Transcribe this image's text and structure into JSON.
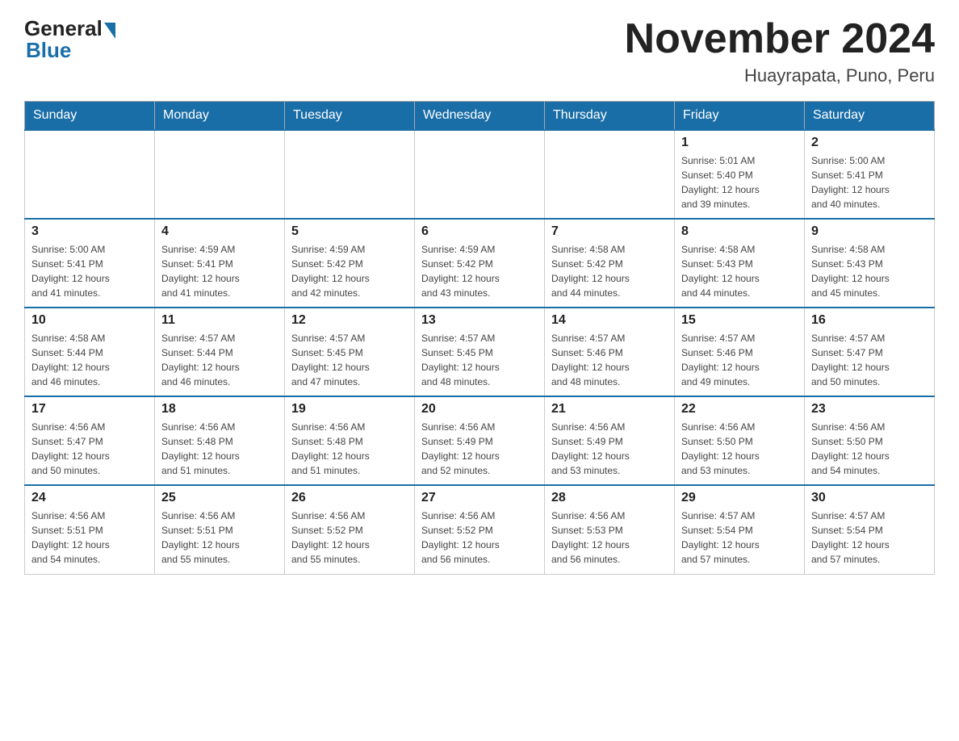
{
  "logo": {
    "general": "General",
    "blue": "Blue"
  },
  "header": {
    "month_title": "November 2024",
    "subtitle": "Huayrapata, Puno, Peru"
  },
  "weekdays": [
    "Sunday",
    "Monday",
    "Tuesday",
    "Wednesday",
    "Thursday",
    "Friday",
    "Saturday"
  ],
  "weeks": [
    [
      {
        "day": "",
        "info": ""
      },
      {
        "day": "",
        "info": ""
      },
      {
        "day": "",
        "info": ""
      },
      {
        "day": "",
        "info": ""
      },
      {
        "day": "",
        "info": ""
      },
      {
        "day": "1",
        "info": "Sunrise: 5:01 AM\nSunset: 5:40 PM\nDaylight: 12 hours\nand 39 minutes."
      },
      {
        "day": "2",
        "info": "Sunrise: 5:00 AM\nSunset: 5:41 PM\nDaylight: 12 hours\nand 40 minutes."
      }
    ],
    [
      {
        "day": "3",
        "info": "Sunrise: 5:00 AM\nSunset: 5:41 PM\nDaylight: 12 hours\nand 41 minutes."
      },
      {
        "day": "4",
        "info": "Sunrise: 4:59 AM\nSunset: 5:41 PM\nDaylight: 12 hours\nand 41 minutes."
      },
      {
        "day": "5",
        "info": "Sunrise: 4:59 AM\nSunset: 5:42 PM\nDaylight: 12 hours\nand 42 minutes."
      },
      {
        "day": "6",
        "info": "Sunrise: 4:59 AM\nSunset: 5:42 PM\nDaylight: 12 hours\nand 43 minutes."
      },
      {
        "day": "7",
        "info": "Sunrise: 4:58 AM\nSunset: 5:42 PM\nDaylight: 12 hours\nand 44 minutes."
      },
      {
        "day": "8",
        "info": "Sunrise: 4:58 AM\nSunset: 5:43 PM\nDaylight: 12 hours\nand 44 minutes."
      },
      {
        "day": "9",
        "info": "Sunrise: 4:58 AM\nSunset: 5:43 PM\nDaylight: 12 hours\nand 45 minutes."
      }
    ],
    [
      {
        "day": "10",
        "info": "Sunrise: 4:58 AM\nSunset: 5:44 PM\nDaylight: 12 hours\nand 46 minutes."
      },
      {
        "day": "11",
        "info": "Sunrise: 4:57 AM\nSunset: 5:44 PM\nDaylight: 12 hours\nand 46 minutes."
      },
      {
        "day": "12",
        "info": "Sunrise: 4:57 AM\nSunset: 5:45 PM\nDaylight: 12 hours\nand 47 minutes."
      },
      {
        "day": "13",
        "info": "Sunrise: 4:57 AM\nSunset: 5:45 PM\nDaylight: 12 hours\nand 48 minutes."
      },
      {
        "day": "14",
        "info": "Sunrise: 4:57 AM\nSunset: 5:46 PM\nDaylight: 12 hours\nand 48 minutes."
      },
      {
        "day": "15",
        "info": "Sunrise: 4:57 AM\nSunset: 5:46 PM\nDaylight: 12 hours\nand 49 minutes."
      },
      {
        "day": "16",
        "info": "Sunrise: 4:57 AM\nSunset: 5:47 PM\nDaylight: 12 hours\nand 50 minutes."
      }
    ],
    [
      {
        "day": "17",
        "info": "Sunrise: 4:56 AM\nSunset: 5:47 PM\nDaylight: 12 hours\nand 50 minutes."
      },
      {
        "day": "18",
        "info": "Sunrise: 4:56 AM\nSunset: 5:48 PM\nDaylight: 12 hours\nand 51 minutes."
      },
      {
        "day": "19",
        "info": "Sunrise: 4:56 AM\nSunset: 5:48 PM\nDaylight: 12 hours\nand 51 minutes."
      },
      {
        "day": "20",
        "info": "Sunrise: 4:56 AM\nSunset: 5:49 PM\nDaylight: 12 hours\nand 52 minutes."
      },
      {
        "day": "21",
        "info": "Sunrise: 4:56 AM\nSunset: 5:49 PM\nDaylight: 12 hours\nand 53 minutes."
      },
      {
        "day": "22",
        "info": "Sunrise: 4:56 AM\nSunset: 5:50 PM\nDaylight: 12 hours\nand 53 minutes."
      },
      {
        "day": "23",
        "info": "Sunrise: 4:56 AM\nSunset: 5:50 PM\nDaylight: 12 hours\nand 54 minutes."
      }
    ],
    [
      {
        "day": "24",
        "info": "Sunrise: 4:56 AM\nSunset: 5:51 PM\nDaylight: 12 hours\nand 54 minutes."
      },
      {
        "day": "25",
        "info": "Sunrise: 4:56 AM\nSunset: 5:51 PM\nDaylight: 12 hours\nand 55 minutes."
      },
      {
        "day": "26",
        "info": "Sunrise: 4:56 AM\nSunset: 5:52 PM\nDaylight: 12 hours\nand 55 minutes."
      },
      {
        "day": "27",
        "info": "Sunrise: 4:56 AM\nSunset: 5:52 PM\nDaylight: 12 hours\nand 56 minutes."
      },
      {
        "day": "28",
        "info": "Sunrise: 4:56 AM\nSunset: 5:53 PM\nDaylight: 12 hours\nand 56 minutes."
      },
      {
        "day": "29",
        "info": "Sunrise: 4:57 AM\nSunset: 5:54 PM\nDaylight: 12 hours\nand 57 minutes."
      },
      {
        "day": "30",
        "info": "Sunrise: 4:57 AM\nSunset: 5:54 PM\nDaylight: 12 hours\nand 57 minutes."
      }
    ]
  ]
}
